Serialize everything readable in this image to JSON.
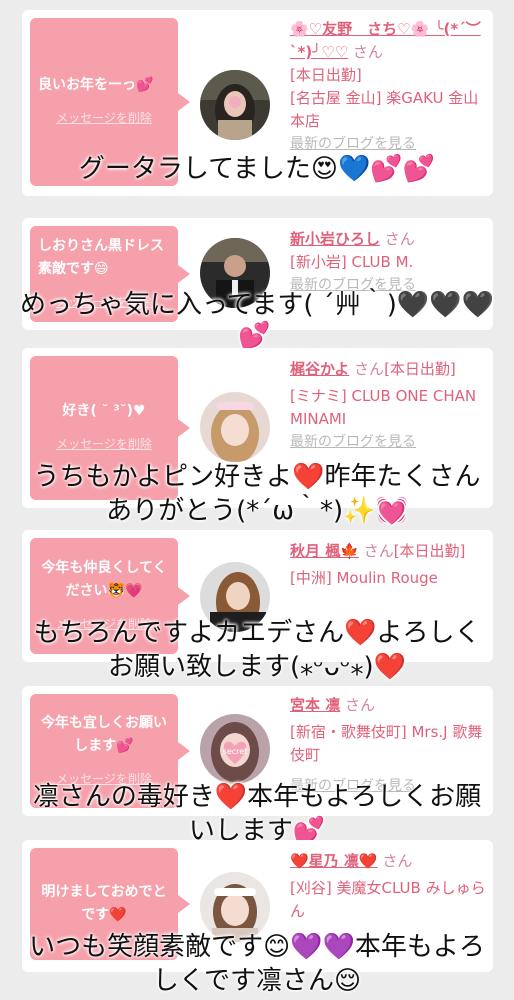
{
  "delete_link_label": "メッセージを削除",
  "blog_link_label": "最新のブログを見る",
  "san_suffix": "さん",
  "colors": {
    "bubble": "#f5a0ab",
    "link": "#e0617a",
    "overlay_text": "#111111"
  },
  "messages": [
    {
      "bubble_text": "良いお年をーっ💕",
      "name": "🌸♡友野　さち♡🌸 ╰(*´︶`*)╯♡♡",
      "lines": [
        "[本日出勤]",
        "[名古屋 金山] 楽GAKU 金山本店"
      ],
      "comment": [
        "グータラしてました😍💙💕💕"
      ]
    },
    {
      "bubble_text": "しおりさん黒ドレス素敵です😄",
      "name": "新小岩ひろし",
      "lines": [
        "[新小岩] CLUB M."
      ],
      "comment": [
        "めっちゃ気に入ってます( ´艸｀)🖤🖤🖤",
        "💕"
      ]
    },
    {
      "bubble_text": "好き( ˘ ³˘)♥",
      "name": "梶谷かよ",
      "lines": [
        "[本日出勤]",
        "[ミナミ] CLUB ONE CHAN MINAMI"
      ],
      "comment": [
        "うちもかよピン好きよ❤️昨年たくさん",
        "ありがとう(*´ω｀*)✨💓"
      ]
    },
    {
      "bubble_text": "今年も仲良くしてください🐯💗",
      "name": "秋月 楓🍁",
      "lines": [
        "[本日出勤]",
        "[中洲] Moulin Rouge"
      ],
      "comment": [
        "もちろんですよカエデさん❤️よろしく",
        "お願い致します(⁎ᵕᴗᵕ⁎)❤️"
      ]
    },
    {
      "bubble_text": "今年も宜しくお願いします💕",
      "name": "宮本 凛",
      "lines": [
        "[新宿・歌舞伎町] Mrs.J 歌舞伎町"
      ],
      "comment": [
        "凛さんの毒好き❤️本年もよろしくお願",
        "いします💕"
      ]
    },
    {
      "bubble_text": "明けましておめでとです❤️",
      "name": "❤️星乃 凛❤️",
      "lines": [
        "[刈谷] 美魔女CLUB みしゅらん"
      ],
      "comment": [
        "いつも笑顔素敵です😊💜💜本年もよろ",
        "しくです凛さん😌"
      ]
    }
  ]
}
